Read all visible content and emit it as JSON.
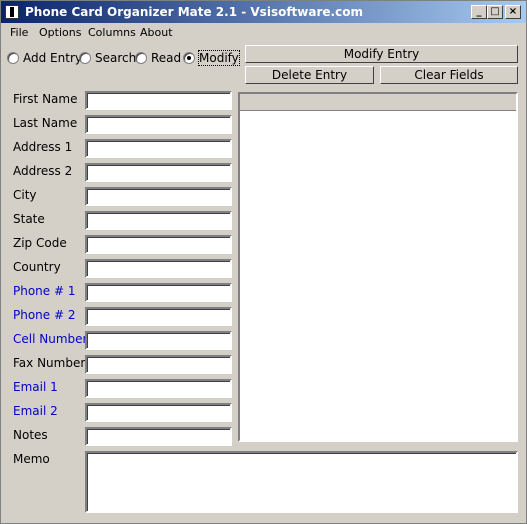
{
  "window": {
    "title": "Phone Card Organizer Mate 2.1 - Vsisoftware.com",
    "min_glyph": "_",
    "max_glyph": "□",
    "close_glyph": "×"
  },
  "menu": {
    "file": "File",
    "options": "Options",
    "columns": "Columns",
    "about": "About"
  },
  "modes": {
    "add": "Add Entry",
    "search": "Search",
    "read": "Read",
    "modify": "Modify",
    "selected": "modify"
  },
  "buttons": {
    "modify_entry": "Modify Entry",
    "delete_entry": "Delete Entry",
    "clear_fields": "Clear Fields"
  },
  "fields": {
    "first_name": "First Name",
    "last_name": "Last Name",
    "address1": "Address 1",
    "address2": "Address 2",
    "city": "City",
    "state": "State",
    "zip": "Zip Code",
    "country": "Country",
    "phone1": "Phone # 1",
    "phone2": "Phone # 2",
    "cell": "Cell Number",
    "fax": "Fax Number",
    "email1": "Email 1",
    "email2": "Email 2",
    "notes": "Notes",
    "memo": "Memo"
  },
  "colors": {
    "highlight_label": "#0000c8",
    "titlebar_start": "#0a246a",
    "titlebar_end": "#a6caf0"
  }
}
